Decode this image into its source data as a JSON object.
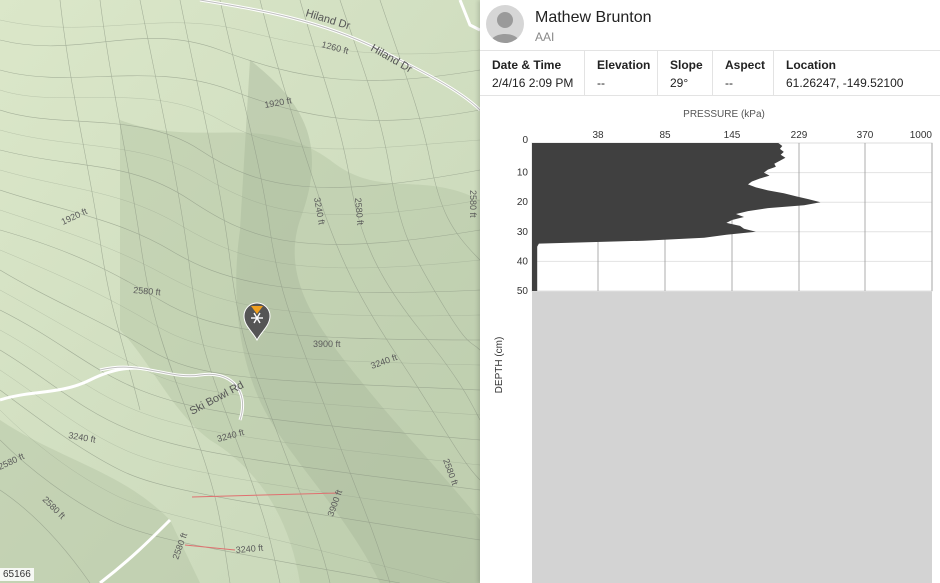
{
  "map": {
    "road_labels": [
      "Hiland Dr",
      "Hiland Dr",
      "Ski Bowl Rd"
    ],
    "contour_labels": [
      "1260 ft",
      "1920 ft",
      "1920 ft",
      "3240 ft",
      "2580 ft",
      "2580 ft",
      "3900 ft",
      "3240 ft",
      "3240 ft",
      "3240 ft",
      "2580 ft",
      "2580 ft",
      "2580 ft",
      "3900 ft",
      "2580 ft",
      "3240 ft",
      "2580 ft",
      "1920 ft"
    ],
    "scale_text": "65166",
    "marker_icon": "snowflake-observation-icon"
  },
  "panel": {
    "user_name": "Mathew Brunton",
    "user_org": "AAI",
    "meta": {
      "datetime_label": "Date & Time",
      "datetime_value": "2/4/16 2:09 PM",
      "elevation_label": "Elevation",
      "elevation_value": "--",
      "slope_label": "Slope",
      "slope_value": "29°",
      "aspect_label": "Aspect",
      "aspect_value": "--",
      "location_label": "Location",
      "location_value": "61.26247, -149.52100"
    }
  },
  "chart_data": {
    "type": "area",
    "title": "PRESSURE (kPa)",
    "xlabel": "PRESSURE (kPa)",
    "ylabel": "DEPTH (cm)",
    "x_ticks": [
      "38",
      "85",
      "145",
      "229",
      "370",
      "1000"
    ],
    "y_ticks": [
      "0",
      "10",
      "20",
      "30",
      "40",
      "50"
    ],
    "y_range": [
      0,
      50
    ],
    "fill_color": "#404040",
    "no_data_color": "#d3d3d3",
    "profile": [
      [
        0,
        203
      ],
      [
        1,
        208
      ],
      [
        2,
        205
      ],
      [
        3,
        210
      ],
      [
        4,
        206
      ],
      [
        5,
        212
      ],
      [
        6,
        205
      ],
      [
        7,
        198
      ],
      [
        8,
        200
      ],
      [
        9,
        190
      ],
      [
        10,
        185
      ],
      [
        11,
        192
      ],
      [
        12,
        180
      ],
      [
        13,
        170
      ],
      [
        14,
        165
      ],
      [
        15,
        175
      ],
      [
        16,
        190
      ],
      [
        17,
        210
      ],
      [
        18,
        225
      ],
      [
        19,
        250
      ],
      [
        20,
        275
      ],
      [
        21,
        240
      ],
      [
        22,
        190
      ],
      [
        23,
        165
      ],
      [
        24,
        150
      ],
      [
        25,
        160
      ],
      [
        26,
        145
      ],
      [
        27,
        140
      ],
      [
        28,
        155
      ],
      [
        29,
        160
      ],
      [
        30,
        175
      ],
      [
        31,
        140
      ],
      [
        32,
        120
      ],
      [
        33,
        70
      ],
      [
        34,
        4
      ],
      [
        35,
        3
      ],
      [
        40,
        3
      ],
      [
        45,
        3
      ],
      [
        50,
        3
      ]
    ]
  }
}
